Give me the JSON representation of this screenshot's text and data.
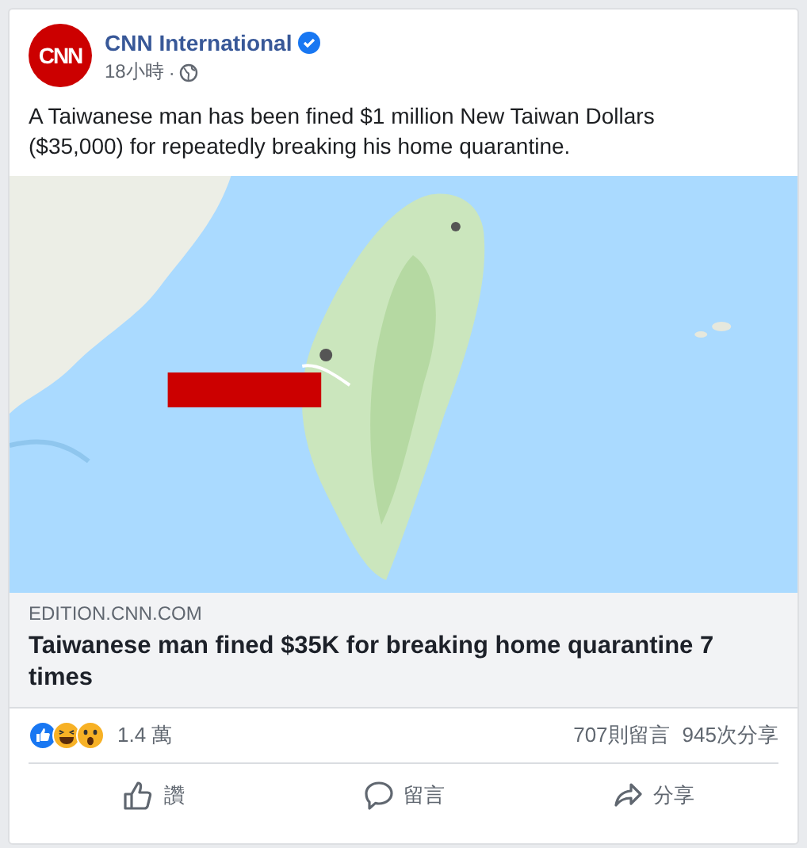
{
  "post": {
    "logo_text": "CNN",
    "author": "CNN International",
    "verified": true,
    "time": "18小時",
    "audience_separator": "·",
    "message": "A Taiwanese man has been fined $1 million New Taiwan Dollars ($35,000) for repeatedly breaking his home quarantine."
  },
  "link_preview": {
    "domain": "EDITION.CNN.COM",
    "title": "Taiwanese man fined $35K for breaking home quarantine 7 times"
  },
  "stats": {
    "reactions": [
      {
        "kind": "like"
      },
      {
        "kind": "haha"
      },
      {
        "kind": "wow"
      }
    ],
    "reaction_count": "1.4 萬",
    "comments": "707則留言",
    "shares": "945次分享"
  },
  "actions": [
    {
      "kind": "like",
      "label": "讚"
    },
    {
      "kind": "comment",
      "label": "留言"
    },
    {
      "kind": "share",
      "label": "分享"
    }
  ]
}
